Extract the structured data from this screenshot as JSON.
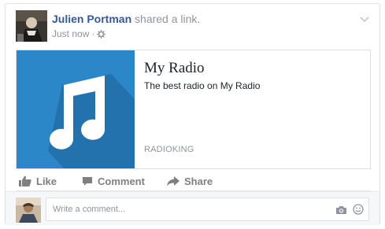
{
  "post": {
    "author_name": "Julien Portman",
    "shared_text": "shared a",
    "link_word": "link.",
    "timestamp": "Just now",
    "separator": "·",
    "privacy_icon": "gear-icon",
    "menu_icon": "chevron-down-icon"
  },
  "link_preview": {
    "title": "My Radio",
    "description": "The best radio on My Radio",
    "domain": "RADIOKING",
    "image_icon": "music-note-icon",
    "image_bg": "#2c87c8"
  },
  "actions": {
    "like_label": "Like",
    "comment_label": "Comment",
    "share_label": "Share"
  },
  "comment": {
    "placeholder": "Write a comment...",
    "camera_icon": "camera-icon",
    "emoji_icon": "smiley-icon"
  },
  "colors": {
    "author_link": "#365899",
    "muted_text": "#90949c",
    "action_text": "#7f7f7f",
    "border": "#dddfe2"
  }
}
